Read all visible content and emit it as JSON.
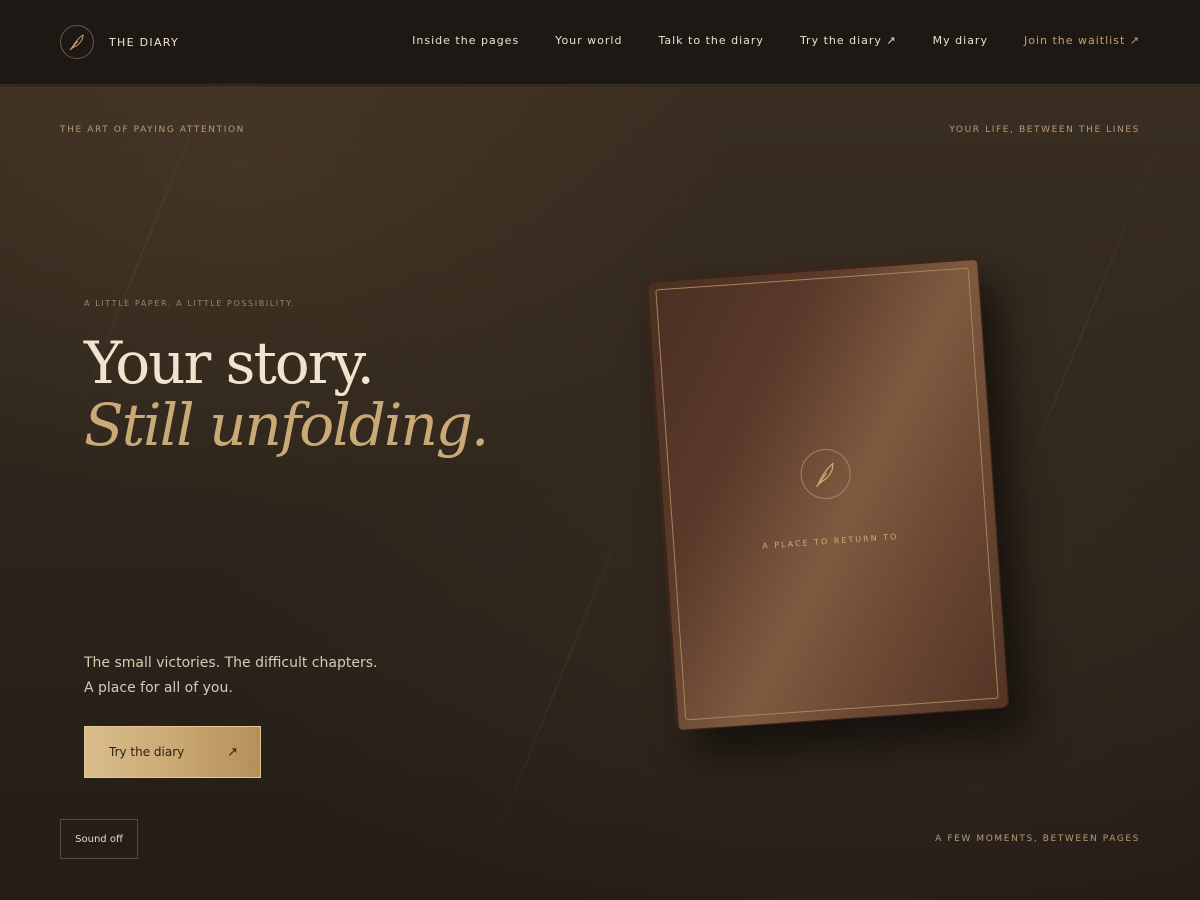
{
  "header": {
    "brand": {
      "name": "THE DIARY",
      "icon": "feather-quill-icon"
    },
    "nav": [
      {
        "label": "Inside the pages",
        "accent": false
      },
      {
        "label": "Your world",
        "accent": false
      },
      {
        "label": "Talk to the diary",
        "accent": false
      },
      {
        "label": "Try the diary ↗",
        "accent": false
      },
      {
        "label": "My diary",
        "accent": false
      },
      {
        "label": "Join the waitlist ↗",
        "accent": true
      }
    ]
  },
  "hero": {
    "top_left_label": "THE ART OF PAYING ATTENTION",
    "top_right_label": "YOUR LIFE, BETWEEN THE LINES",
    "eyebrow": "A LITTLE PAPER. A LITTLE POSSIBILITY.",
    "headline_line1": "Your story.",
    "headline_line2": "Still unfolding.",
    "subcopy_line1": "The small victories. The difficult chapters.",
    "subcopy_line2": "A place for all of you.",
    "cta": {
      "label": "Try the diary",
      "icon": "arrow-up-right-icon",
      "glyph": "↗"
    },
    "sound_button": "Sound off",
    "bottom_right_label": "A FEW MOMENTS, BETWEEN PAGES"
  },
  "book": {
    "caption": "A PLACE TO RETURN TO",
    "emblem_icon": "feather-quill-icon"
  },
  "colors": {
    "header_bg": "#1e1814",
    "accent_gold": "#c5a06b",
    "cta_gold": "#d9bd8c",
    "text_cream": "#f0e4cf"
  }
}
